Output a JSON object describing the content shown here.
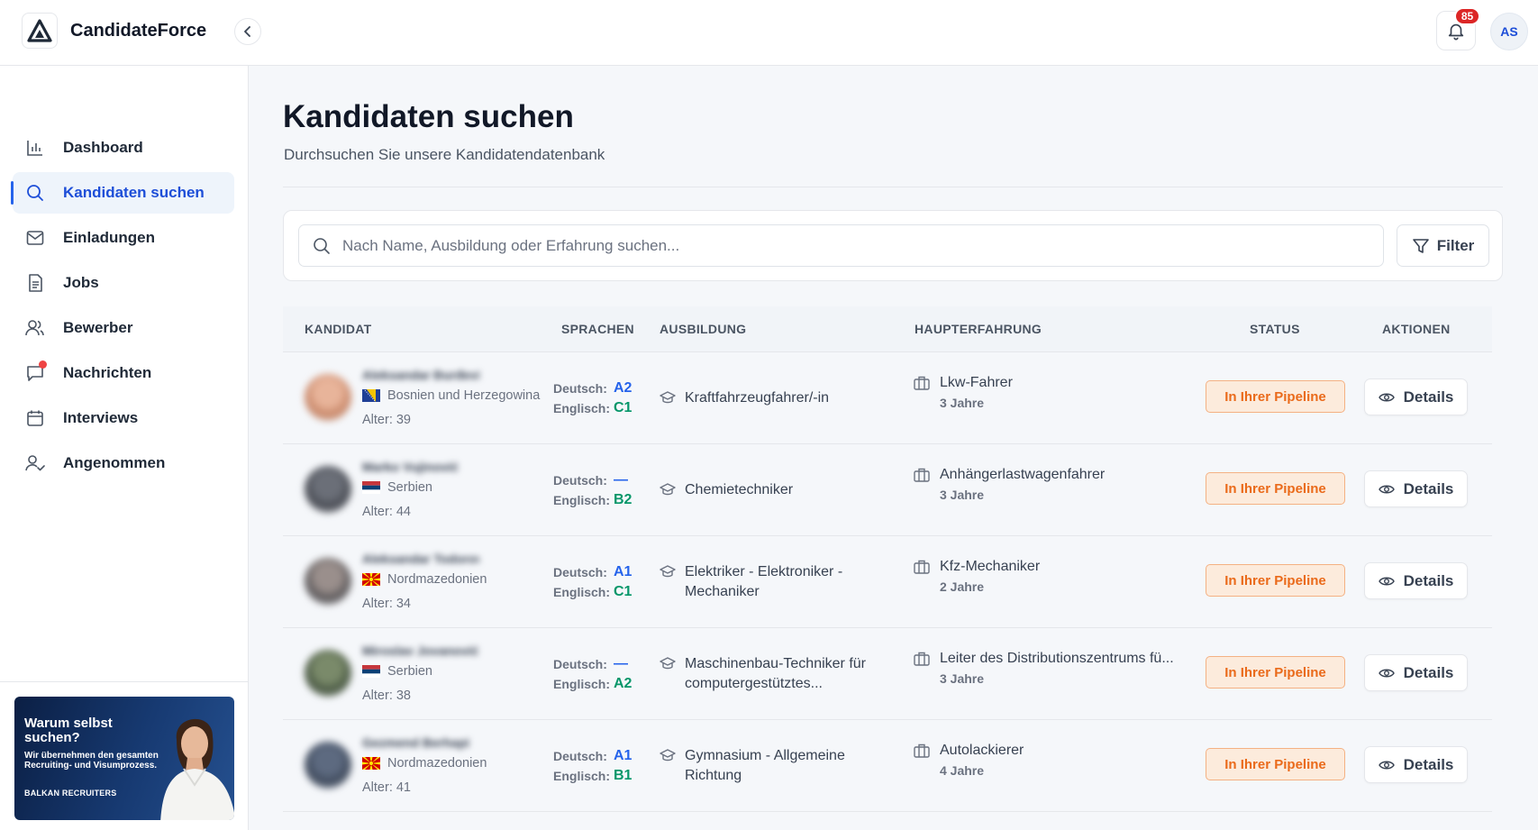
{
  "app": {
    "name": "CandidateForce"
  },
  "header": {
    "notifications_count": "85",
    "user_initials": "AS"
  },
  "sidebar": {
    "items": [
      {
        "label": "Dashboard",
        "icon": "bar-chart-icon",
        "active": false
      },
      {
        "label": "Kandidaten suchen",
        "icon": "search-icon",
        "active": true
      },
      {
        "label": "Einladungen",
        "icon": "mail-icon",
        "active": false
      },
      {
        "label": "Jobs",
        "icon": "document-icon",
        "active": false
      },
      {
        "label": "Bewerber",
        "icon": "users-icon",
        "active": false
      },
      {
        "label": "Nachrichten",
        "icon": "message-icon",
        "active": false
      },
      {
        "label": "Interviews",
        "icon": "calendar-icon",
        "active": false
      },
      {
        "label": "Angenommen",
        "icon": "user-check-icon",
        "active": false
      }
    ],
    "promo": {
      "title": "Warum selbst suchen?",
      "text": "Wir übernehmen den gesamten Recruiting- und Visumprozess.",
      "brand": "BALKAN RECRUITERS"
    }
  },
  "main": {
    "title": "Kandidaten suchen",
    "subtitle": "Durchsuchen Sie unsere Kandidatendatenbank",
    "search": {
      "placeholder": "Nach Name, Ausbildung oder Erfahrung suchen...",
      "value": ""
    },
    "filter_label": "Filter"
  },
  "table": {
    "headers": {
      "candidate": "KANDIDAT",
      "languages": "SPRACHEN",
      "education": "AUSBILDUNG",
      "experience": "HAUPTERFAHRUNG",
      "status": "STATUS",
      "actions": "AKTIONEN"
    },
    "lang_labels": {
      "german": "Deutsch:",
      "english": "Englisch:"
    },
    "details_label": "Details",
    "rows": [
      {
        "name": "Aleksandar Đurđević",
        "country": "Bosnien und Herzegowina",
        "flag": "ba",
        "age": "Alter: 39",
        "german": "A2",
        "english": "C1",
        "education": "Kraftfahrzeugfahrer/-in",
        "experience": "Lkw-Fahrer",
        "years": "3 Jahre",
        "status": "In Ihrer Pipeline"
      },
      {
        "name": "Marko Vujinović",
        "country": "Serbien",
        "flag": "rs",
        "age": "Alter: 44",
        "german": "—",
        "english": "B2",
        "education": "Chemietechniker",
        "experience": "Anhängerlastwagenfahrer",
        "years": "3 Jahre",
        "status": "In Ihrer Pipeline"
      },
      {
        "name": "Aleksandar Todorov",
        "country": "Nordmazedonien",
        "flag": "mk",
        "age": "Alter: 34",
        "german": "A1",
        "english": "C1",
        "education": "Elektriker - Elektroniker - Mechaniker",
        "experience": "Kfz-Mechaniker",
        "years": "2 Jahre",
        "status": "In Ihrer Pipeline"
      },
      {
        "name": "Miroslav Jovanović",
        "country": "Serbien",
        "flag": "rs",
        "age": "Alter: 38",
        "german": "—",
        "english": "A2",
        "education": "Maschinenbau-Techniker für computergestütztes...",
        "experience": "Leiter des Distributionszentrums fü...",
        "years": "3 Jahre",
        "status": "In Ihrer Pipeline"
      },
      {
        "name": "Gezmend Berhapi",
        "country": "Nordmazedonien",
        "flag": "mk",
        "age": "Alter: 41",
        "german": "A1",
        "english": "B1",
        "education": "Gymnasium - Allgemeine Richtung",
        "experience": "Autolackierer",
        "years": "4 Jahre",
        "status": "In Ihrer Pipeline"
      }
    ]
  },
  "colors": {
    "accent": "#2563eb",
    "status_bg": "#fcebdc",
    "status_text": "#ea6a1a",
    "badge": "#dc2626"
  }
}
